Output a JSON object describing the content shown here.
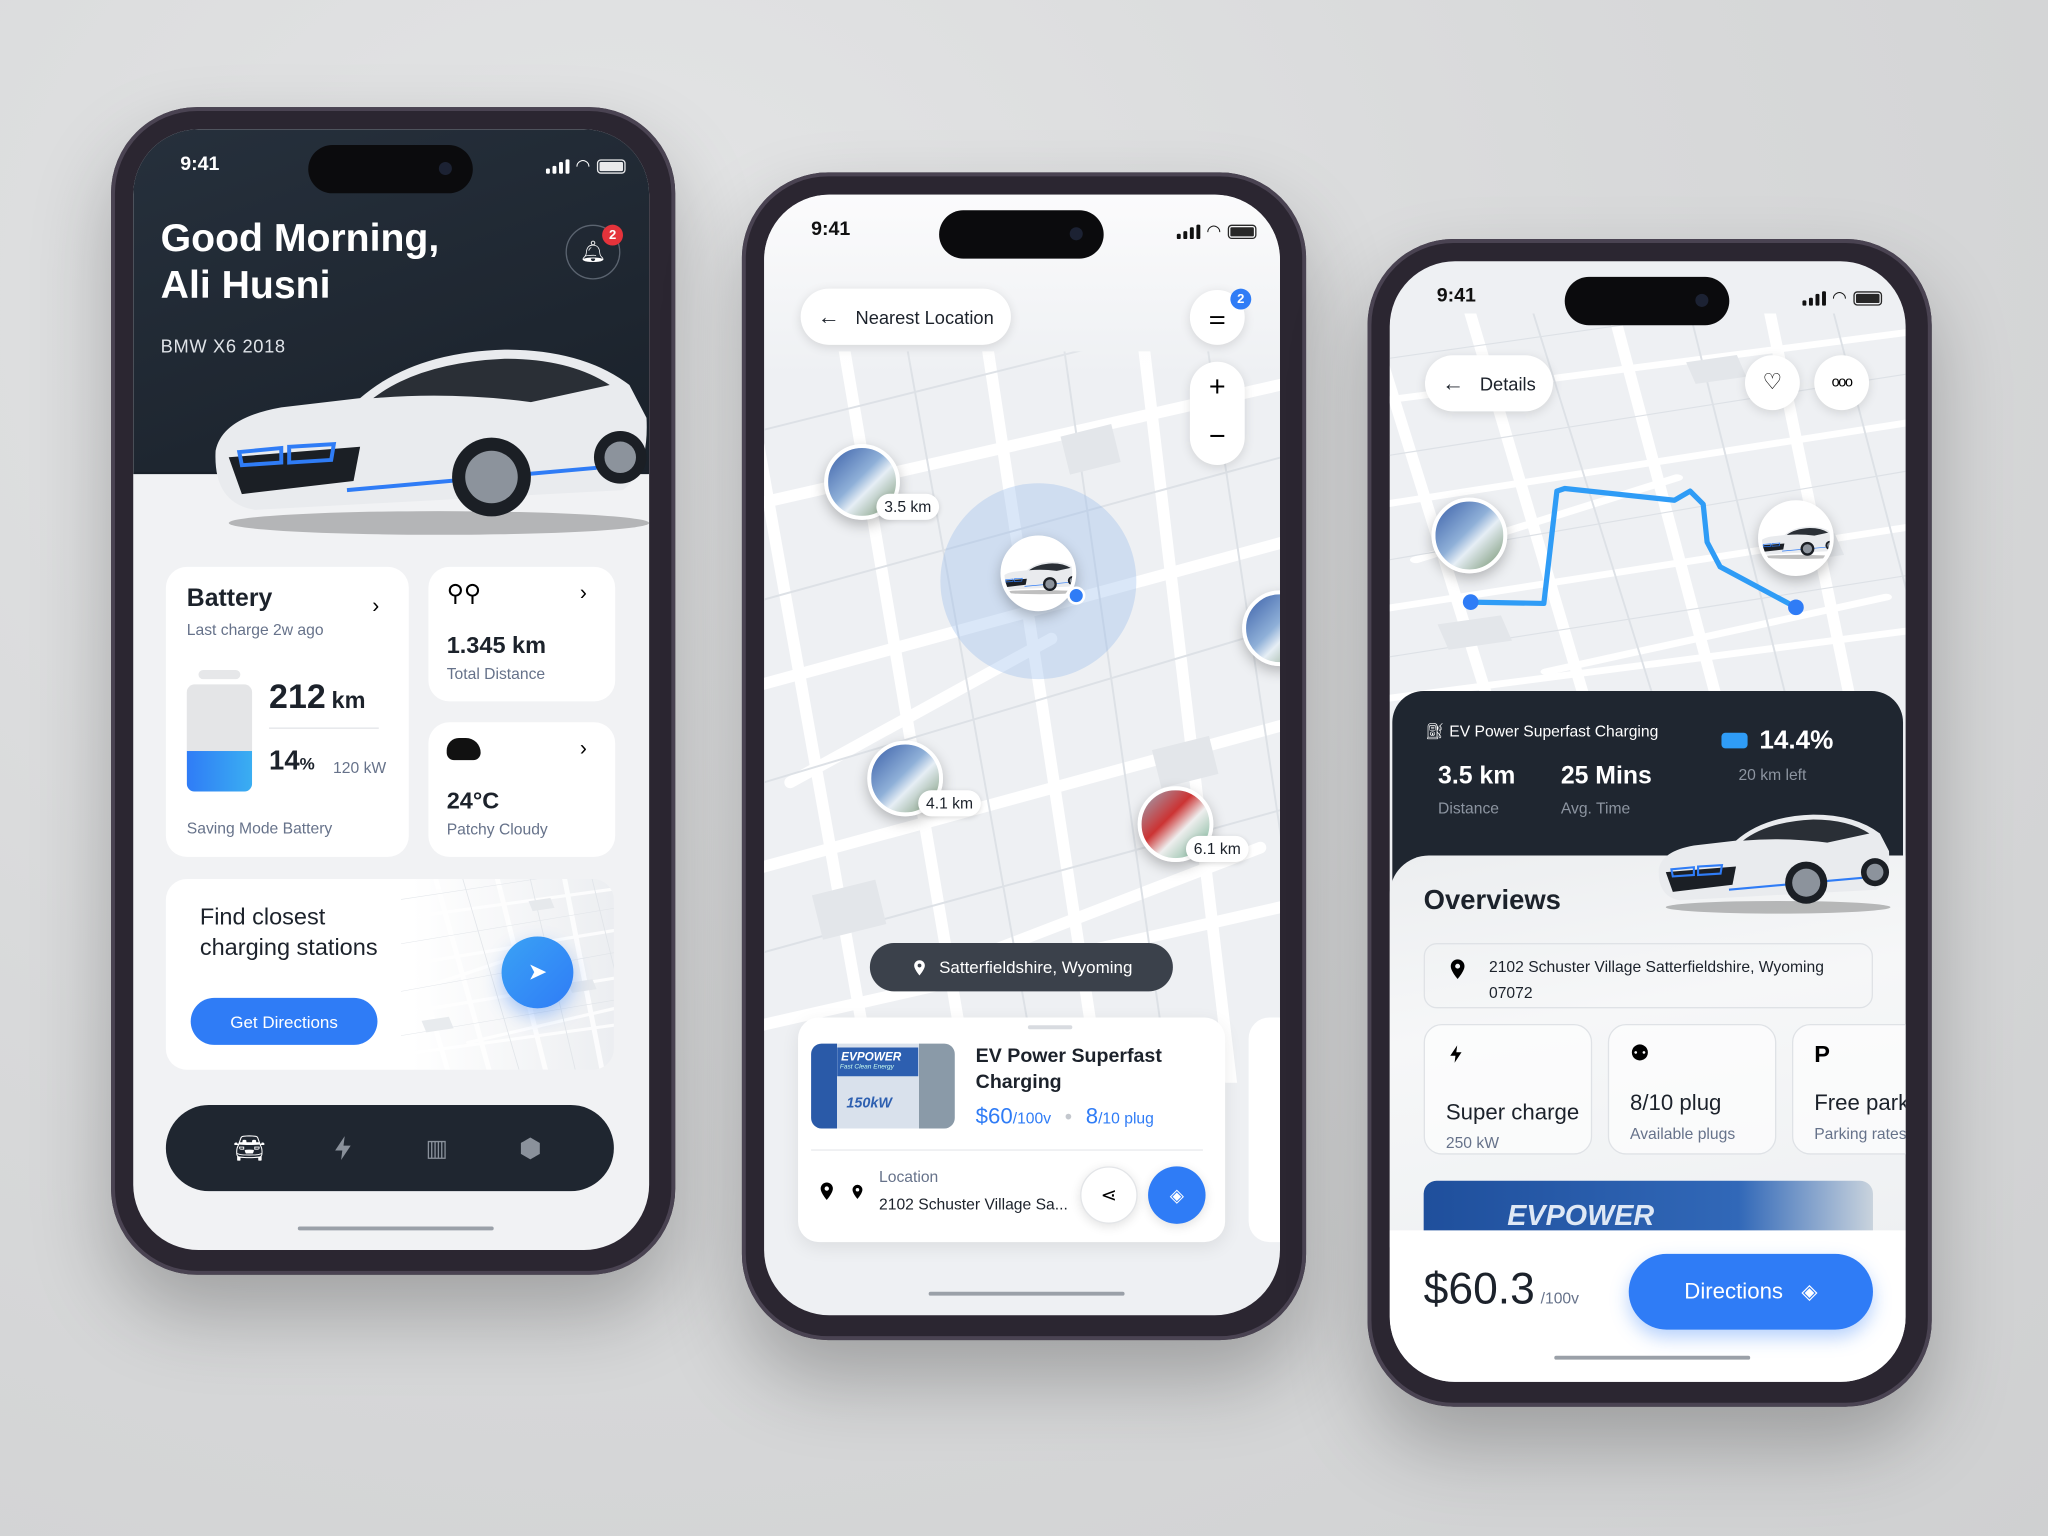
{
  "status": {
    "time": "9:41"
  },
  "home": {
    "greeting": "Good Morning,",
    "user_name": "Ali Husni",
    "car_model": "BMW X6 2018",
    "notification_count": "2",
    "battery": {
      "title": "Battery",
      "subtitle": "Last charge 2w ago",
      "range_value": "212",
      "range_unit": "km",
      "percent_value": "14",
      "percent_unit": "%",
      "power": "120 kW",
      "footer": "Saving Mode Battery",
      "level": 0.14
    },
    "distance": {
      "value": "1.345 km",
      "label": "Total Distance"
    },
    "weather": {
      "value": "24°C",
      "label": "Patchy Cloudy"
    },
    "find": {
      "title_line1": "Find closest",
      "title_line2": "charging stations",
      "button": "Get Directions"
    },
    "nav": [
      "car-icon",
      "lightning-icon",
      "map-icon",
      "settings-icon"
    ]
  },
  "map": {
    "back_label": "Nearest Location",
    "filter_count": "2",
    "zoom_in": "+",
    "zoom_out": "−",
    "markers": [
      {
        "distance": "3.5 km"
      },
      {
        "distance": "4.1 km"
      },
      {
        "distance": "6.1 km"
      }
    ],
    "location_pill": "Satterfieldshire, Wyoming",
    "station": {
      "name": "EV Power Superfast Charging",
      "price": "$60",
      "price_unit": "/100v",
      "plugs": "8",
      "plugs_unit": "/10 plug",
      "location_label": "Location",
      "address": "2102 Schuster Village Sa...",
      "thumb_brand": "EVPOWER",
      "thumb_tag": "Fast Clean Energy",
      "thumb_power": "150kW"
    }
  },
  "details": {
    "back_label": "Details",
    "station_name": "EV Power Superfast Charging",
    "distance": {
      "value": "3.5 km",
      "label": "Distance"
    },
    "time": {
      "value": "25 Mins",
      "label": "Avg. Time"
    },
    "battery": {
      "value": "14.4%",
      "label": "20 km left"
    },
    "overviews_title": "Overviews",
    "address_line1": "2102 Schuster Village Satterfieldshire,  Wyoming",
    "address_line2": "07072",
    "features": [
      {
        "icon": "lightning-icon",
        "title": "Super charge",
        "sub": "250 kW"
      },
      {
        "icon": "plug-icon",
        "title": "8/10 plug",
        "sub": "Available plugs"
      },
      {
        "icon": "P",
        "title": "Free parking",
        "sub": "Parking rates"
      }
    ],
    "photo_brand": "EVPOWER",
    "price": "$60.3",
    "price_unit": "/100v",
    "directions": "Directions"
  },
  "colors": {
    "accent": "#2f7cf6",
    "dark": "#1f2630",
    "badge": "#e5333b"
  }
}
